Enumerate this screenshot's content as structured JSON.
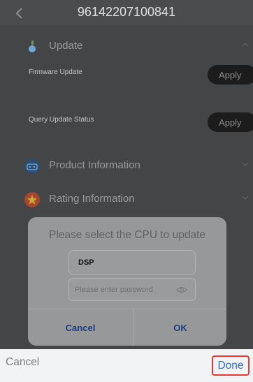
{
  "header": {
    "title": "96142207100841"
  },
  "sections": {
    "update": {
      "label": "Update"
    },
    "product_info": {
      "label": "Product Information"
    },
    "rating_info": {
      "label": "Rating Information"
    }
  },
  "update_items": [
    {
      "label": "Firmware Update",
      "button": "Apply"
    },
    {
      "label": "Query Update Status",
      "button": "Apply"
    }
  ],
  "dialog": {
    "title": "Please select the CPU to update",
    "cpu_value": "DSP",
    "password_placeholder": "Please enter password",
    "password_value": "",
    "cancel_label": "Cancel",
    "ok_label": "OK"
  },
  "picker_bar": {
    "cancel_label": "Cancel",
    "done_label": "Done"
  },
  "colors": {
    "done_highlight": "#e53935",
    "done_text": "#2a6cdc",
    "dialog_button_text": "#1f3d86"
  },
  "icons": {
    "back": "chevron-left-icon",
    "update": "update-icon",
    "product_info": "router-icon",
    "rating_info": "star-badge-icon",
    "password_visibility": "eye-icon"
  }
}
